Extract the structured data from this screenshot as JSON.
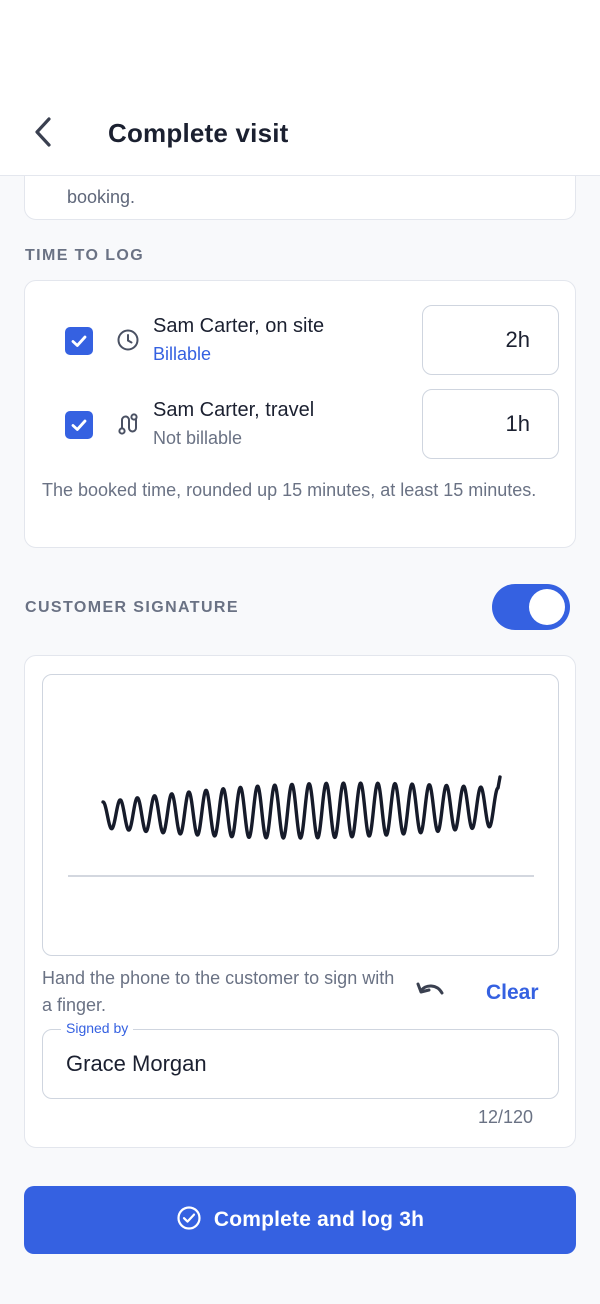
{
  "header": {
    "title": "Complete visit",
    "back_icon": "chevron-left-icon"
  },
  "notes_card": {
    "text_fragment": "booking."
  },
  "time_section": {
    "title": "TIME TO LOG",
    "entries": [
      {
        "checked": true,
        "icon": "clock-icon",
        "name": "Sam Carter, on site",
        "billing": "Billable",
        "hours": "2h"
      },
      {
        "checked": true,
        "icon": "route-icon",
        "name": "Sam Carter, travel",
        "billing": "Not billable",
        "hours": "1h"
      }
    ],
    "hint": "The booked time, rounded up 15 minutes, at least 15 minutes."
  },
  "signature_section": {
    "title": "CUSTOMER SIGNATURE",
    "toggle_on": true,
    "hint": "Hand the phone to the customer to sign with a finger.",
    "undo_icon": "undo-icon",
    "clear_label": "Clear",
    "signed_by_label": "Signed by",
    "signed_by_value": "Grace Morgan",
    "char_count": "12/120"
  },
  "primary_action": {
    "icon": "check-circle-icon",
    "label": "Complete and log 3h"
  },
  "colors": {
    "accent": "#3561e1",
    "text_primary": "#1b2030",
    "text_secondary": "#6a7284",
    "background": "#f8f9fb"
  }
}
